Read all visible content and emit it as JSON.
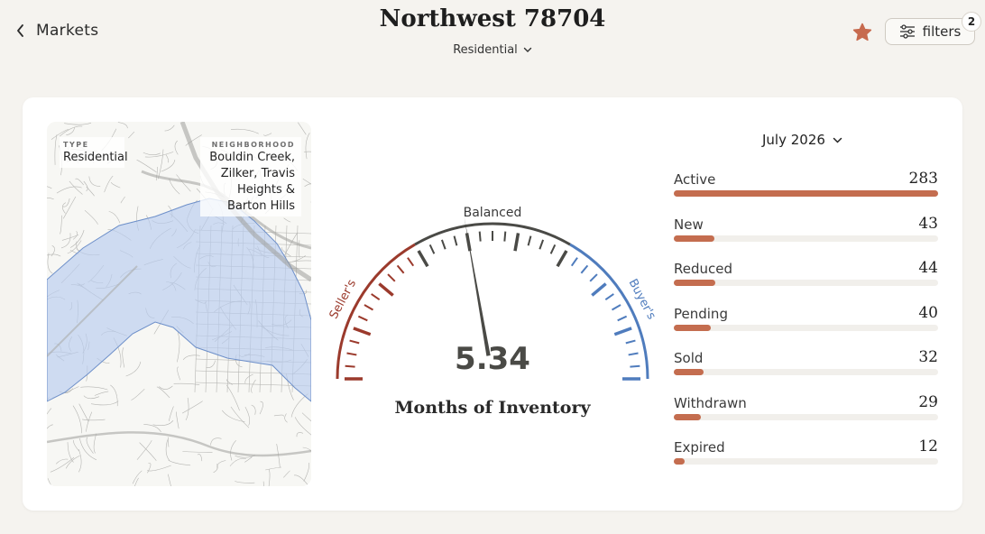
{
  "header": {
    "back_label": "Markets",
    "title": "Northwest 78704",
    "type_selected": "Residential",
    "filters_label": "filters",
    "filters_count": "2",
    "accent_color": "#c76a4e"
  },
  "map": {
    "type_heading": "TYPE",
    "type_value": "Residential",
    "neighborhood_heading": "NEIGHBORHOOD",
    "neighborhood_lines": [
      "Bouldin Creek,",
      "Zilker, Travis",
      "Heights &",
      "Barton Hills"
    ],
    "highlight_color": "#b9cdef"
  },
  "gauge": {
    "value": "5.34",
    "numeric_value": 5.34,
    "title": "Months of Inventory",
    "top_label": "Balanced",
    "left_label": "Seller's",
    "right_label": "Buyer's",
    "seller_color": "#9b3a2c",
    "balanced_color": "#4a4a46",
    "buyer_color": "#4f7cbd"
  },
  "stats": {
    "month_selected": "July 2026",
    "max": 283,
    "bar_color": "#c46d4f",
    "items": [
      {
        "label": "Active",
        "value": "283",
        "amount": 283
      },
      {
        "label": "New",
        "value": "43",
        "amount": 43
      },
      {
        "label": "Reduced",
        "value": "44",
        "amount": 44
      },
      {
        "label": "Pending",
        "value": "40",
        "amount": 40
      },
      {
        "label": "Sold",
        "value": "32",
        "amount": 32
      },
      {
        "label": "Withdrawn",
        "value": "29",
        "amount": 29
      },
      {
        "label": "Expired",
        "value": "12",
        "amount": 12
      }
    ]
  }
}
